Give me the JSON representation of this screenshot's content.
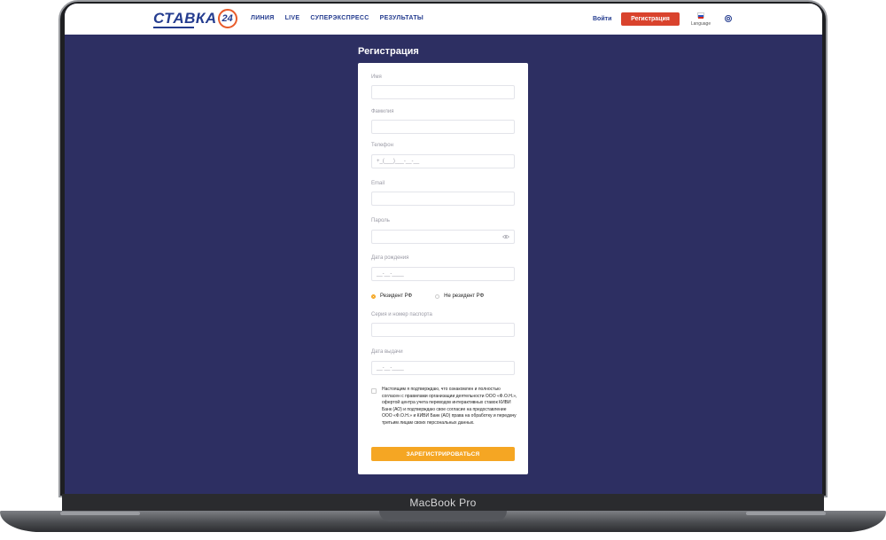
{
  "header": {
    "logo_text": "СТАВКА",
    "logo_badge": "24",
    "nav": [
      "ЛИНИЯ",
      "LIVE",
      "СУПЕРЭКСПРЕСС",
      "РЕЗУЛЬТАТЫ"
    ],
    "login": "Войти",
    "register": "Регистрация",
    "language": "Language"
  },
  "form": {
    "title": "Регистрация",
    "fields": {
      "first_name": {
        "label": "Имя",
        "value": ""
      },
      "last_name": {
        "label": "Фамилия",
        "value": ""
      },
      "phone": {
        "label": "Телефон",
        "value": "+_(___)___-__-__"
      },
      "email": {
        "label": "Email",
        "value": ""
      },
      "password": {
        "label": "Пароль",
        "value": ""
      },
      "birth_date": {
        "label": "Дата рождения",
        "value": "__-__-____"
      },
      "passport": {
        "label": "Серия и номер паспорта",
        "value": ""
      },
      "issue_date": {
        "label": "Дата выдачи",
        "value": "__-__-____"
      }
    },
    "residency": {
      "resident": "Резидент РФ",
      "non_resident": "Не резидент РФ",
      "selected": "resident"
    },
    "consent_text": "Настоящим я подтверждаю, что ознакомлен и полностью согласен с правилами организации деятельности ООО «Ф.О.Н.», офертой центра учета переводов интерактивных ставок КИВИ Банк (АО) и подтверждаю свое согласие на предоставление ООО «Ф.О.Н.» и КИВИ Банк (АО) права на обработку и передачу третьим лицам своих персональных данных.",
    "submit": "ЗАРЕГИСТРИРОВАТЬСЯ"
  },
  "device": {
    "label": "MacBook Pro"
  },
  "colors": {
    "page_bg": "#2d2f62",
    "brand_blue": "#243c8f",
    "register_red": "#d9432d",
    "accent_orange": "#f5a623"
  }
}
